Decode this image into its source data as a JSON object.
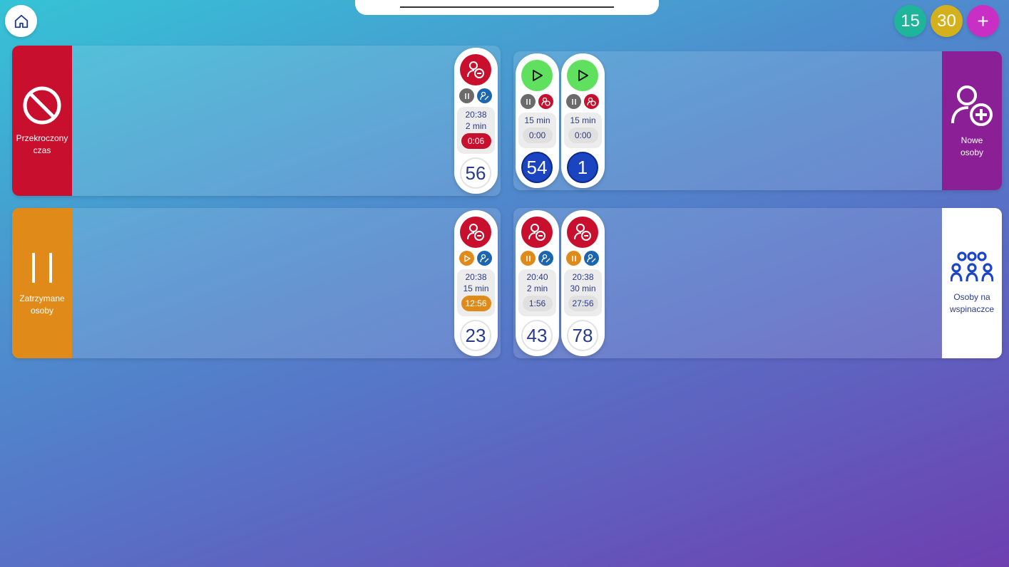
{
  "quick_buttons": [
    {
      "label": "15",
      "color": "#1fb59a"
    },
    {
      "label": "30",
      "color": "#d4b01c"
    },
    {
      "label": "+",
      "color": "#c92fc4"
    }
  ],
  "colors": {
    "red": "#c8102e",
    "orange": "#e08a1a",
    "purple": "#8a1f96",
    "green": "#5fe05f",
    "grey": "#6b6b6b",
    "blue": "#1b66b0",
    "navy": "#2a3a8c"
  },
  "sections": {
    "overtime": {
      "label": "Przekroczony\nczas",
      "icon": "prohibited-icon"
    },
    "paused": {
      "label": "Zatrzymane\nosoby",
      "icon": "pause-icon"
    },
    "new": {
      "label": "Nowe\nosoby",
      "icon": "add-person-icon"
    },
    "climbing": {
      "label": "Osoby na\nwspinaczce",
      "icon": "group-icon"
    }
  },
  "overtime_cards": [
    {
      "start": "20:38",
      "duration": "2 min",
      "elapsed": "0:06",
      "number": "56"
    }
  ],
  "paused_cards": [
    {
      "start": "20:38",
      "duration": "15 min",
      "elapsed": "12:56",
      "number": "23"
    }
  ],
  "new_cards": [
    {
      "duration": "15 min",
      "elapsed": "0:00",
      "number": "54"
    },
    {
      "duration": "15 min",
      "elapsed": "0:00",
      "number": "1"
    }
  ],
  "climbing_cards": [
    {
      "start": "20:40",
      "duration": "2 min",
      "elapsed": "1:56",
      "number": "43"
    },
    {
      "start": "20:38",
      "duration": "30 min",
      "elapsed": "27:56",
      "number": "78"
    }
  ]
}
